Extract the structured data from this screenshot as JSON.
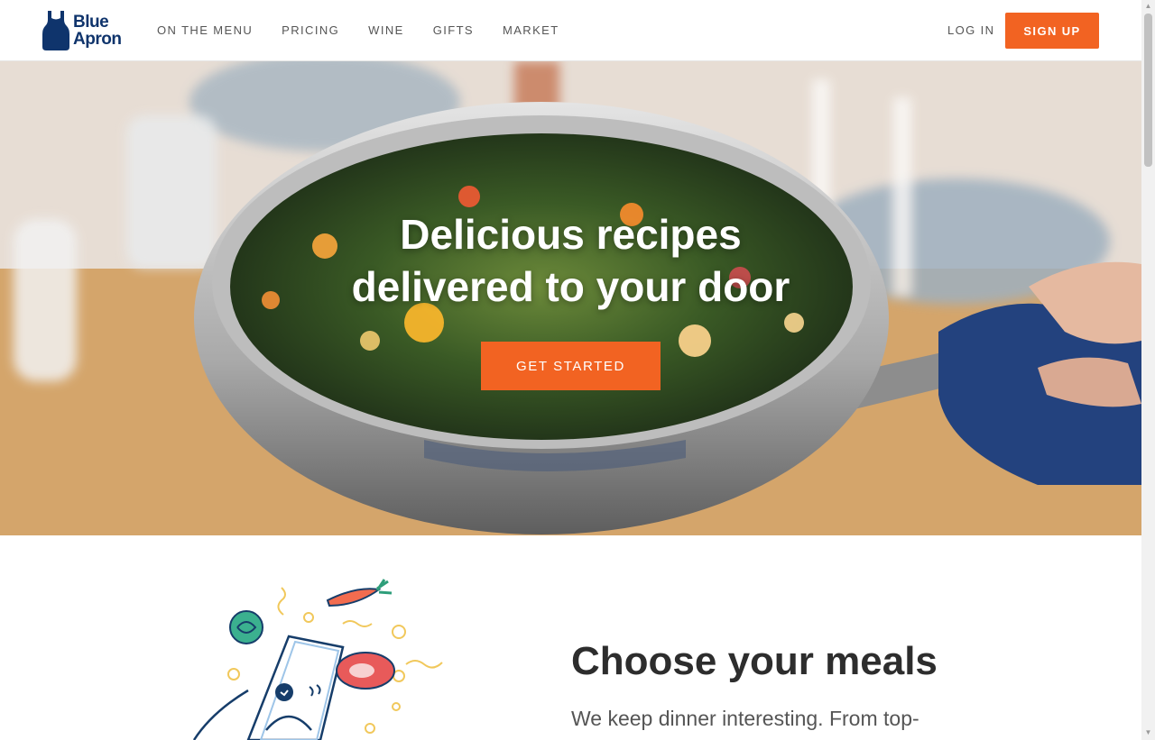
{
  "brand": {
    "logo_text_line1": "Blue",
    "logo_text_line2": "Apron",
    "color": "#0f346c"
  },
  "nav": {
    "items": [
      {
        "label": "ON THE MENU"
      },
      {
        "label": "PRICING"
      },
      {
        "label": "WINE"
      },
      {
        "label": "GIFTS"
      },
      {
        "label": "MARKET"
      }
    ],
    "login_label": "LOG IN",
    "signup_label": "SIGN UP"
  },
  "hero": {
    "title_line1": "Delicious recipes",
    "title_line2": "delivered to your door",
    "cta_label": "GET STARTED",
    "accent_color": "#f26322"
  },
  "section": {
    "title": "Choose your meals",
    "text": "We keep dinner interesting. From top-"
  },
  "icons": [
    "apron-logo-icon",
    "phone-illustration",
    "carrot-icon",
    "cabbage-icon",
    "steak-icon"
  ]
}
